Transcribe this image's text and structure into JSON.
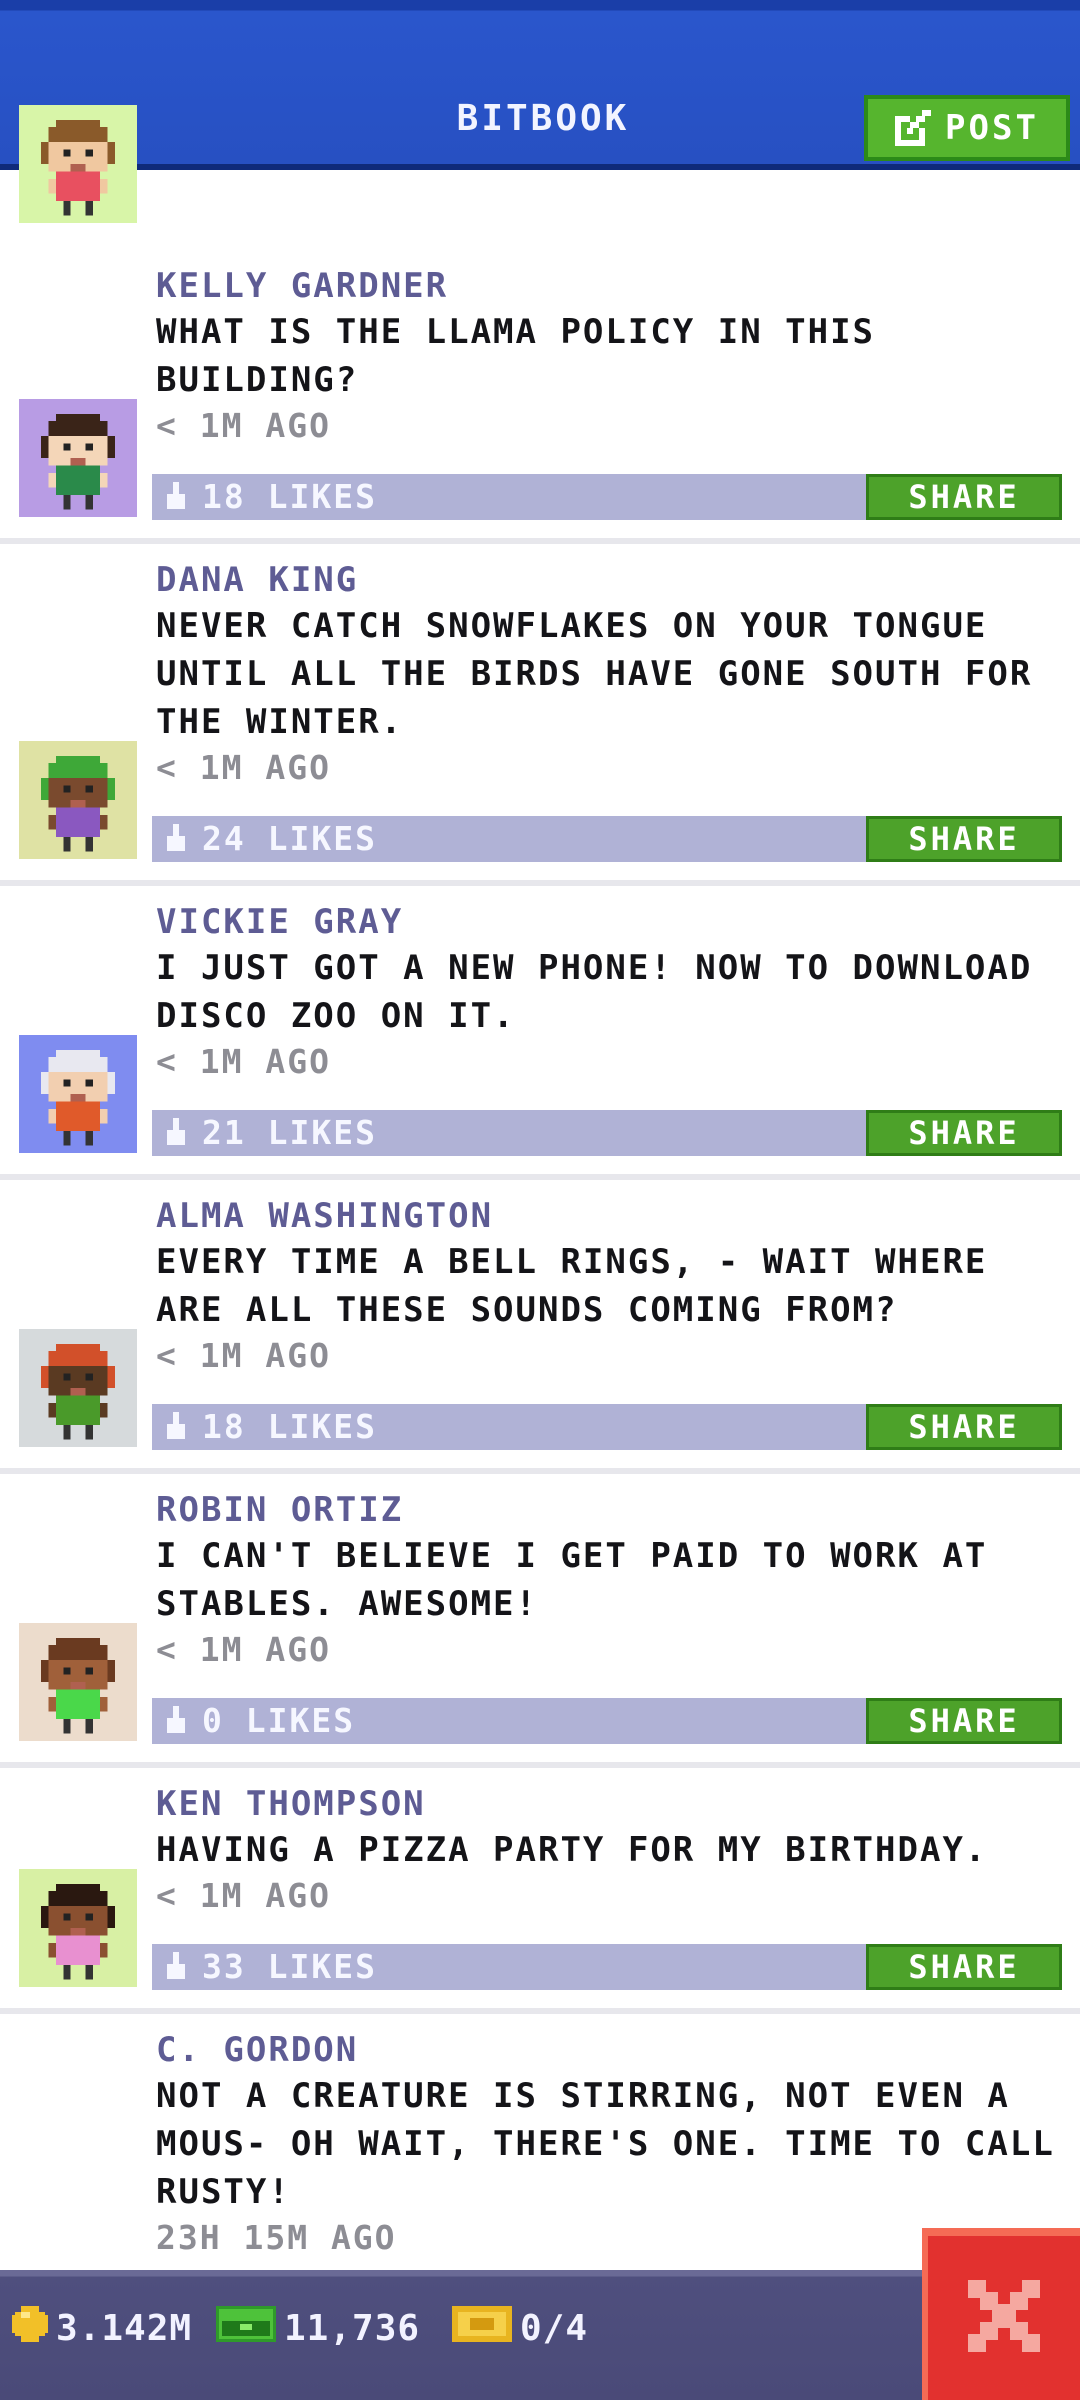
{
  "header": {
    "title": "BITBOOK",
    "post_label": "POST"
  },
  "posts": [
    {
      "name": "KELLY GARDNER",
      "message": "WHAT IS THE LLAMA POLICY IN THIS BUILDING?",
      "time": "< 1M AGO",
      "likes": "18 LIKES",
      "share": "SHARE",
      "avatar_bg": "#d8f5a8",
      "skin": "#f0c8a0",
      "hair": "#8a5a2a",
      "shirt": "#e85060"
    },
    {
      "name": "DANA KING",
      "message": "NEVER CATCH SNOWFLAKES ON YOUR TONGUE UNTIL ALL THE BIRDS HAVE GONE SOUTH FOR THE WINTER.",
      "time": "< 1M AGO",
      "likes": "24 LIKES",
      "share": "SHARE",
      "avatar_bg": "#b89ce4",
      "skin": "#f4d6b8",
      "hair": "#3a2418",
      "shirt": "#2a8a4a"
    },
    {
      "name": "VICKIE GRAY",
      "message": "I JUST GOT A NEW PHONE! NOW TO DOWNLOAD DISCO ZOO ON IT.",
      "time": "< 1M AGO",
      "likes": "21 LIKES",
      "share": "SHARE",
      "avatar_bg": "#dfe2a4",
      "skin": "#7a4a2e",
      "hair": "#3ea838",
      "shirt": "#8a58c0"
    },
    {
      "name": "ALMA WASHINGTON",
      "message": "EVERY TIME A BELL RINGS, - WAIT WHERE ARE ALL THESE SOUNDS COMING FROM?",
      "time": "< 1M AGO",
      "likes": "18 LIKES",
      "share": "SHARE",
      "avatar_bg": "#7f8cf0",
      "skin": "#f2cfb0",
      "hair": "#e8e8f0",
      "shirt": "#e05a2a"
    },
    {
      "name": "ROBIN ORTIZ",
      "message": "I CAN'T BELIEVE I GET PAID TO WORK AT STABLES. AWESOME!",
      "time": "< 1M AGO",
      "likes": "0 LIKES",
      "share": "SHARE",
      "avatar_bg": "#d6dadc",
      "skin": "#5a3a22",
      "hair": "#d2502a",
      "shirt": "#4a9a2a"
    },
    {
      "name": "KEN THOMPSON",
      "message": "HAVING A PIZZA PARTY FOR MY BIRTHDAY.",
      "time": "< 1M AGO",
      "likes": "33 LIKES",
      "share": "SHARE",
      "avatar_bg": "#ecdccc",
      "skin": "#a0603a",
      "hair": "#6a3a20",
      "shirt": "#4ad84a"
    },
    {
      "name": "C. GORDON",
      "message": "NOT A CREATURE IS STIRRING, NOT EVEN A MOUS- OH WAIT, THERE'S ONE. TIME TO CALL RUSTY!",
      "time": "23H 15M AGO",
      "likes": "",
      "share": "",
      "avatar_bg": "#d8f0a4",
      "skin": "#8a5030",
      "hair": "#2a1810",
      "shirt": "#e890d0"
    }
  ],
  "footer": {
    "coins": "3.142M",
    "cash": "11,736",
    "tickets": "0/4"
  },
  "colors": {
    "header": "#2750c2",
    "accent_green": "#56b52e",
    "likes_bar": "#b0b2d6",
    "name": "#5e5c94",
    "close": "#e2312f"
  },
  "icons": {
    "post": "edit-icon",
    "likes": "thumb-icon",
    "coin": "coin-icon",
    "cash": "cash-icon",
    "ticket": "ticket-icon",
    "close": "close-icon"
  }
}
